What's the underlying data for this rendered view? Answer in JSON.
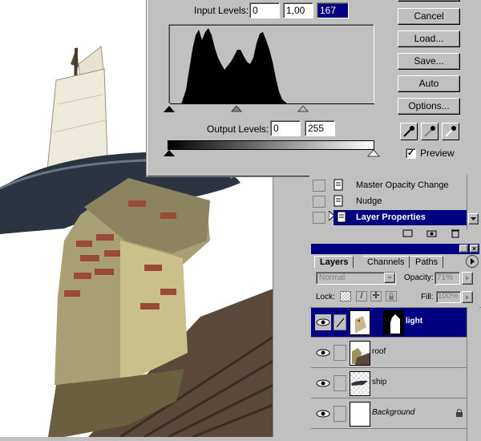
{
  "levels_dialog": {
    "input_levels_label": "Input Levels:",
    "input_values": [
      "0",
      "1,00",
      "167"
    ],
    "output_levels_label": "Output Levels:",
    "output_values": [
      "0",
      "255"
    ],
    "buttons": {
      "cancel": "Cancel",
      "load": "Load...",
      "save": "Save...",
      "auto": "Auto",
      "options": "Options..."
    },
    "preview_label": "Preview",
    "preview_checked": true
  },
  "history_panel": {
    "items": [
      {
        "label": "Master Opacity Change",
        "active": false
      },
      {
        "label": "Nudge",
        "active": false
      },
      {
        "label": "Layer Properties",
        "active": true
      }
    ]
  },
  "layers_panel": {
    "tabs": [
      "Layers",
      "Channels",
      "Paths"
    ],
    "active_tab": "Layers",
    "blend_mode": "Normal",
    "opacity_label": "Opacity:",
    "opacity_value": "71%",
    "lock_label": "Lock:",
    "fill_label": "Fill:",
    "fill_value": "100%",
    "layers": [
      {
        "name": "light",
        "active": true,
        "visible": true
      },
      {
        "name": "roof",
        "active": false,
        "visible": true
      },
      {
        "name": "ship",
        "active": false,
        "visible": true
      },
      {
        "name": "Background",
        "active": false,
        "visible": true,
        "locked": true
      }
    ]
  },
  "colors": {
    "selection": "#000080",
    "panel_bg": "#c0c0c0"
  }
}
